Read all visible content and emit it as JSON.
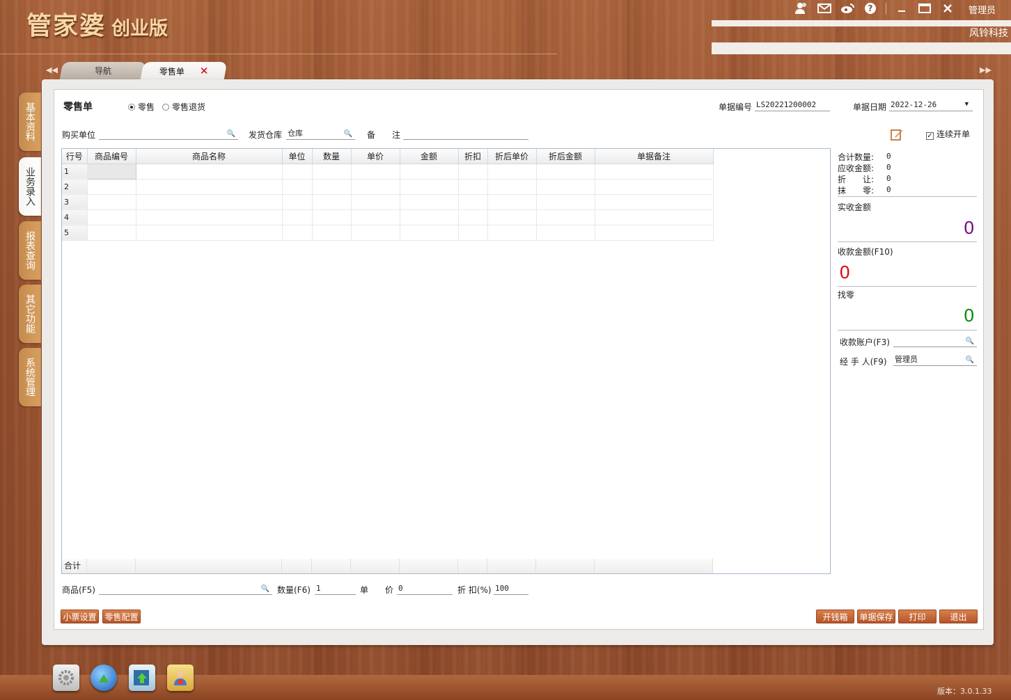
{
  "app": {
    "logo_main": "管家婆",
    "logo_edition": "创业版",
    "user": "管理员",
    "company": "风铃科技",
    "version": "版本：3.0.1.33"
  },
  "tabs": [
    {
      "label": "导航"
    },
    {
      "label": "零售单"
    }
  ],
  "side_tabs": [
    "基本资料",
    "业务录入",
    "报表查询",
    "其它功能",
    "系统管理"
  ],
  "form": {
    "title": "零售单",
    "radio_retail": "零售",
    "radio_return": "零售退货",
    "doc_no_label": "单据编号",
    "doc_no": "LS20221200002",
    "doc_date_label": "单据日期",
    "doc_date": "2022-12-26",
    "buyer_label": "购买单位",
    "buyer": "",
    "warehouse_label": "发货仓库",
    "warehouse": "仓库",
    "remark_label_a": "备",
    "remark_label_b": "注",
    "remark": "",
    "continuous_label": "连续开单"
  },
  "grid": {
    "headers": [
      "行号",
      "商品编号",
      "商品名称",
      "单位",
      "数量",
      "单价",
      "金额",
      "折扣",
      "折后单价",
      "折后金额",
      "单据备注"
    ],
    "rows": [
      "1",
      "2",
      "3",
      "4",
      "5"
    ],
    "total_label": "合计"
  },
  "summary": {
    "total_qty_label": "合计数量:",
    "total_qty": "0",
    "receivable_label": "应收金额:",
    "receivable": "0",
    "discount_label": "折　　让:",
    "discount": "0",
    "rounding_label": "抹　　零:",
    "rounding": "0",
    "actual_label": "实收金额",
    "actual": "0",
    "received_label": "收款金额(F10)",
    "received": "0",
    "change_label": "找零",
    "change": "0",
    "account_label": "收款账户(F3)",
    "account": "",
    "handler_label": "经 手 人(F9)",
    "handler": "管理员"
  },
  "entry": {
    "product_label": "商品(F5)",
    "qty_label": "数量(F6)",
    "qty": "1",
    "price_label_a": "单",
    "price_label_b": "价",
    "price": "0",
    "discount_label": "折 扣(%)",
    "discount": "100"
  },
  "buttons": {
    "ticket_settings": "小票设置",
    "retail_config": "零售配置",
    "open_drawer": "开钱箱",
    "save": "单据保存",
    "print": "打印",
    "exit": "退出"
  },
  "colors": {
    "actual": "#7a0080",
    "received": "#e00000",
    "change": "#008a00"
  }
}
